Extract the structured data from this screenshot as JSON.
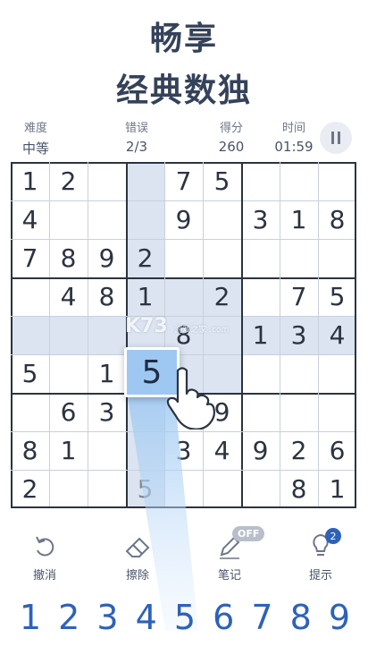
{
  "promo": {
    "line1": "畅享",
    "line2": "经典数独"
  },
  "stats": [
    {
      "label": "难度",
      "value": "中等"
    },
    {
      "label": "错误",
      "value": "2/3"
    },
    {
      "label": "得分",
      "value": "260"
    },
    {
      "label": "时间",
      "value": "01:59"
    }
  ],
  "grid": [
    [
      "1",
      "2",
      "",
      "",
      "7",
      "5",
      "",
      "",
      ""
    ],
    [
      "4",
      "",
      "",
      "",
      "9",
      "",
      "3",
      "1",
      "8"
    ],
    [
      "7",
      "8",
      "9",
      "2",
      "",
      "",
      "",
      "",
      ""
    ],
    [
      "",
      "4",
      "8",
      "1",
      "",
      "2",
      "",
      "7",
      "5"
    ],
    [
      "",
      "",
      "",
      "",
      "8",
      "",
      "1",
      "3",
      "4"
    ],
    [
      "5",
      "",
      "1",
      "5",
      "",
      "",
      "",
      "",
      ""
    ],
    [
      "",
      "6",
      "3",
      "",
      "",
      "9",
      "",
      "",
      ""
    ],
    [
      "8",
      "1",
      "",
      "",
      "3",
      "4",
      "9",
      "2",
      "6"
    ],
    [
      "2",
      "",
      "",
      "5",
      "",
      "",
      "",
      "8",
      "1"
    ]
  ],
  "selected_value": "5",
  "watermark": {
    "brand": "K73",
    "sub": "游戏之家 .com"
  },
  "tools": [
    {
      "label": "撤消",
      "icon": "undo-icon"
    },
    {
      "label": "擦除",
      "icon": "eraser-icon"
    },
    {
      "label": "笔记",
      "icon": "pencil-icon",
      "badge": "OFF"
    },
    {
      "label": "提示",
      "icon": "lightbulb-icon",
      "badge": "2"
    }
  ],
  "numpad": [
    "1",
    "2",
    "3",
    "4",
    "5",
    "6",
    "7",
    "8",
    "9"
  ],
  "colors": {
    "accent": "#2d62b8",
    "highlight": "#dbe4f0",
    "selected": "#9ec8f2"
  }
}
